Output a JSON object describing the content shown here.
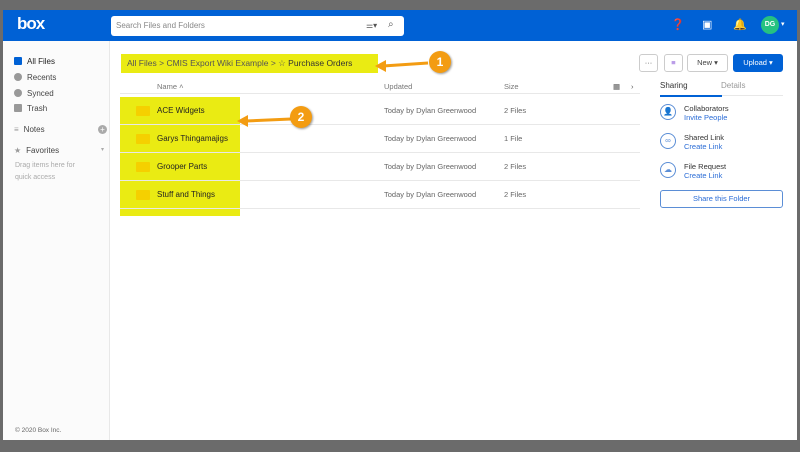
{
  "header": {
    "logo": "box",
    "search_placeholder": "Search Files and Folders",
    "avatar_initials": "DG",
    "brand_color": "#0061d5"
  },
  "sidebar": {
    "items": [
      {
        "label": "All Files",
        "icon": "folder-icon"
      },
      {
        "label": "Recents",
        "icon": "clock-icon"
      },
      {
        "label": "Synced",
        "icon": "sync-icon"
      },
      {
        "label": "Trash",
        "icon": "trash-icon"
      }
    ],
    "notes": "Notes",
    "favorites": "Favorites",
    "favorites_hint_1": "Drag items here for",
    "favorites_hint_2": "quick access",
    "footer": "© 2020 Box Inc."
  },
  "breadcrumb": {
    "items": [
      "All Files",
      "CMIS Export Wiki Example",
      "Purchase Orders"
    ]
  },
  "table": {
    "headers": {
      "name": "Name",
      "updated": "Updated",
      "size": "Size"
    },
    "rows": [
      {
        "name": "ACE Widgets",
        "updated": "Today by Dylan Greenwood",
        "size": "2 Files"
      },
      {
        "name": "Garys Thingamajigs",
        "updated": "Today by Dylan Greenwood",
        "size": "1 File"
      },
      {
        "name": "Grooper Parts",
        "updated": "Today by Dylan Greenwood",
        "size": "2 Files"
      },
      {
        "name": "Stuff and Things",
        "updated": "Today by Dylan Greenwood",
        "size": "2 Files"
      }
    ]
  },
  "toolbar": {
    "more": "···",
    "new": "New ▾",
    "upload": "Upload ▾"
  },
  "panel": {
    "tabs": [
      "Sharing",
      "Details"
    ],
    "items": [
      {
        "title": "Collaborators",
        "link": "Invite People"
      },
      {
        "title": "Shared Link",
        "link": "Create Link"
      },
      {
        "title": "File Request",
        "link": "Create Link"
      }
    ],
    "share_button": "Share this Folder"
  },
  "annotations": [
    "1",
    "2"
  ],
  "highlight_color": "#eaeb13",
  "annotation_color": "#f39c12"
}
